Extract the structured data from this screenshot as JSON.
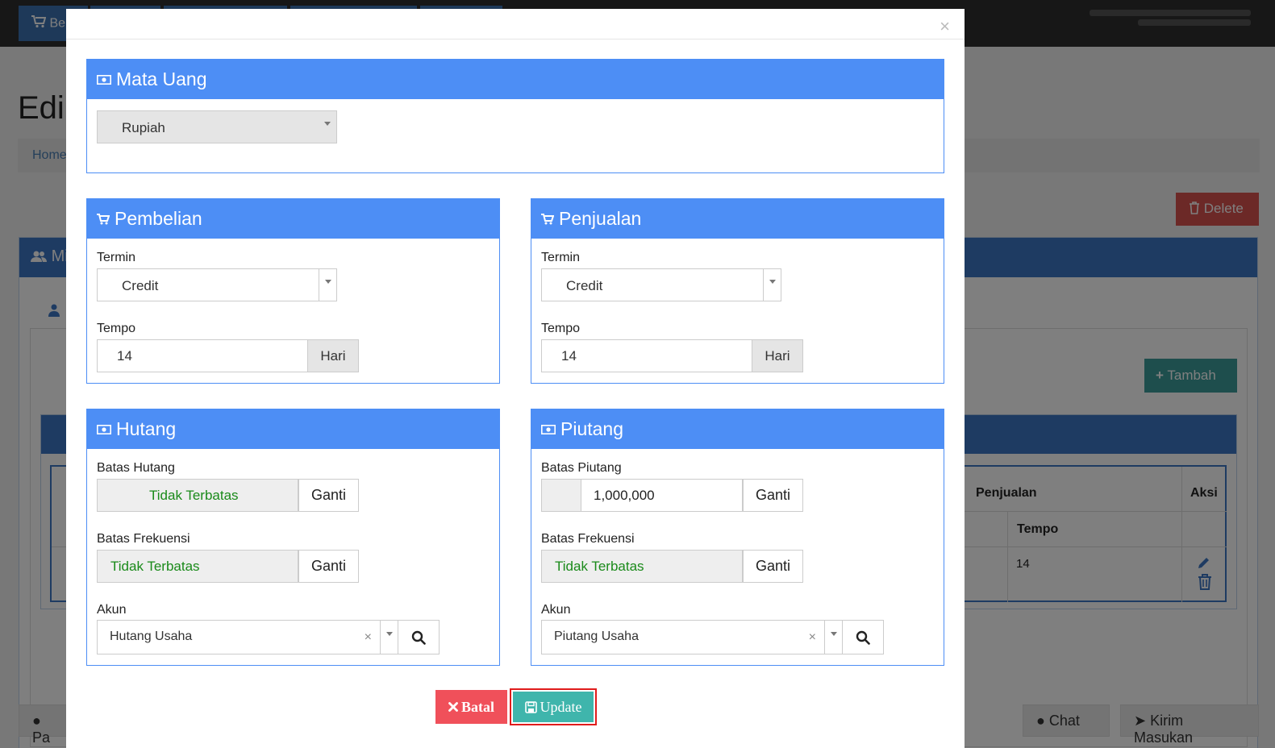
{
  "background": {
    "top_buttons": [
      "Be"
    ],
    "page_title": "Edi",
    "breadcrumb": "Home",
    "delete_label": "Delete",
    "panel_title": "Mi",
    "tambah_label": "Tambah",
    "table": {
      "header_penjualan": "Penjualan",
      "header_aksi": "Aksi",
      "header_tempo": "Tempo",
      "row_tempo": "14"
    },
    "bottom_left_label": "Pa",
    "chat_label": "Chat",
    "kirim_label": "Kirim Masukan"
  },
  "modal": {
    "close_symbol": "×",
    "mata_uang": {
      "title": "Mata Uang",
      "value": "Rupiah"
    },
    "pembelian": {
      "title": "Pembelian",
      "termin_label": "Termin",
      "termin_value": "Credit",
      "tempo_label": "Tempo",
      "tempo_value": "14",
      "tempo_unit": "Hari"
    },
    "penjualan": {
      "title": "Penjualan",
      "termin_label": "Termin",
      "termin_value": "Credit",
      "tempo_label": "Tempo",
      "tempo_value": "14",
      "tempo_unit": "Hari"
    },
    "hutang": {
      "title": "Hutang",
      "batas_label": "Batas Hutang",
      "batas_value": "Tidak Terbatas",
      "frekuensi_label": "Batas Frekuensi",
      "frekuensi_value": "Tidak Terbatas",
      "ganti_label": "Ganti",
      "akun_label": "Akun",
      "akun_value": "Hutang Usaha",
      "clear_symbol": "×"
    },
    "piutang": {
      "title": "Piutang",
      "batas_label": "Batas Piutang",
      "batas_value": "1,000,000",
      "frekuensi_label": "Batas Frekuensi",
      "frekuensi_value": "Tidak Terbatas",
      "ganti_label": "Ganti",
      "akun_label": "Akun",
      "akun_value": "Piutang Usaha",
      "clear_symbol": "×"
    },
    "batal_label": "Batal",
    "update_label": "Update"
  },
  "colors": {
    "panel_blue": "#4d8ef5",
    "batal_red": "#f0505a",
    "update_teal": "#3fb5ac",
    "limit_green": "#1a8a1a",
    "highlight_red": "#e01c1c"
  }
}
